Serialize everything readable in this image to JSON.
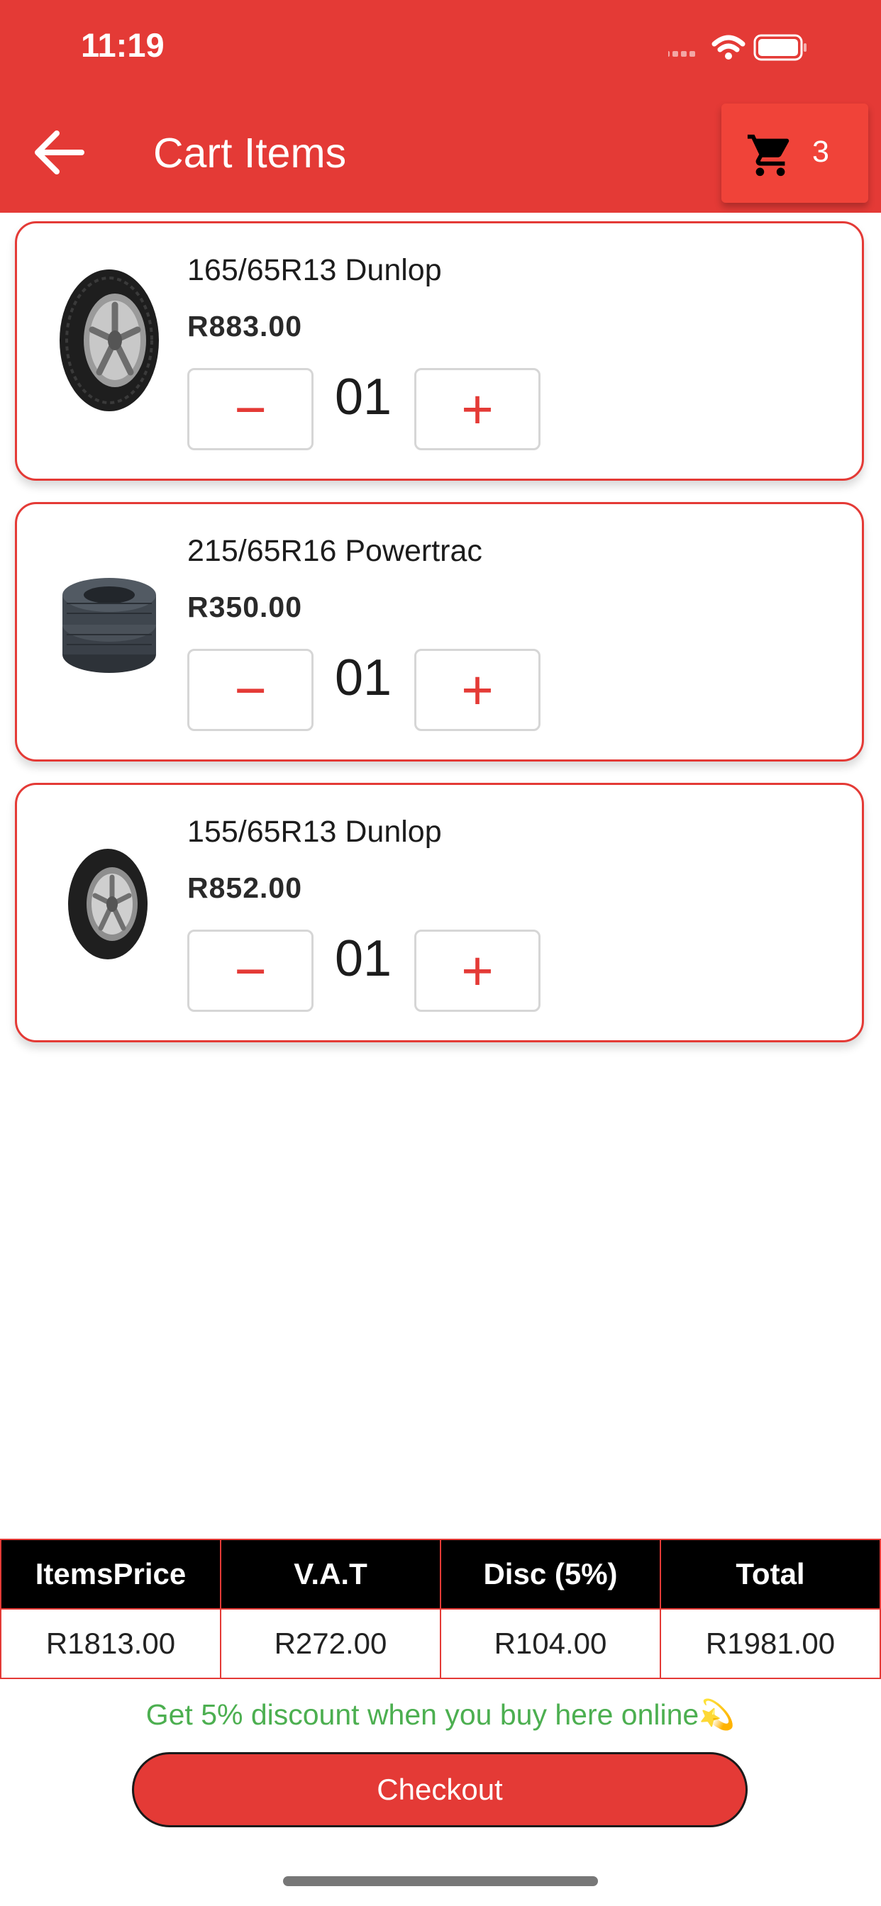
{
  "status_bar": {
    "time": "11:19"
  },
  "header": {
    "title": "Cart Items",
    "cart_count": "3"
  },
  "cart_items": [
    {
      "name": "165/65R13 Dunlop",
      "price": "R883.00",
      "quantity": "01",
      "minus_label": "−",
      "plus_label": "+"
    },
    {
      "name": "215/65R16 Powertrac",
      "price": "R350.00",
      "quantity": "01",
      "minus_label": "−",
      "plus_label": "+"
    },
    {
      "name": "155/65R13 Dunlop",
      "price": "R852.00",
      "quantity": "01",
      "minus_label": "−",
      "plus_label": "+"
    }
  ],
  "summary": {
    "headers": [
      "ItemsPrice",
      "V.A.T",
      "Disc (5%)",
      "Total"
    ],
    "values": [
      "R1813.00",
      "R272.00",
      "R104.00",
      "R1981.00"
    ]
  },
  "promo_text": "Get 5% discount when you buy here online💫",
  "checkout_label": "Checkout",
  "colors": {
    "primary": "#e43a36",
    "promo": "#4caf50"
  }
}
